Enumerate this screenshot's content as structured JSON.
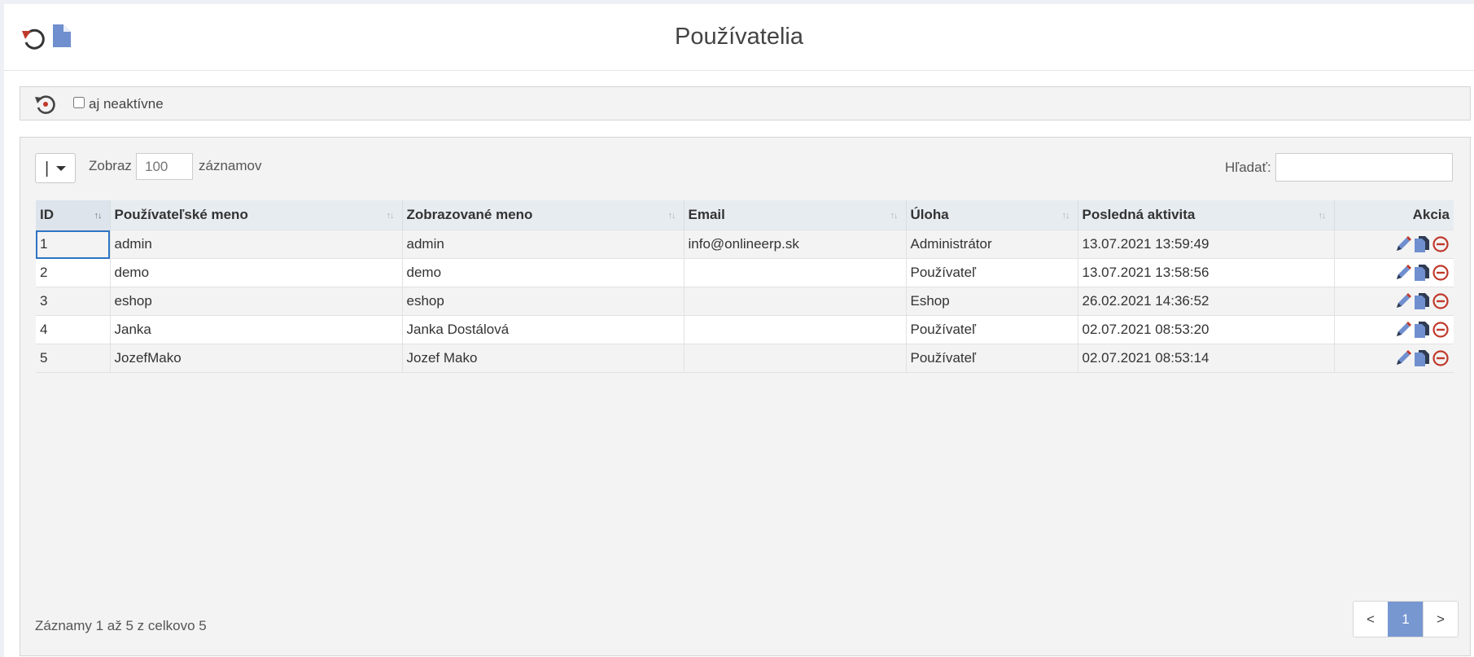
{
  "header": {
    "title": "Používatelia",
    "refresh_icon": "refresh-icon",
    "export_icon": "document-icon"
  },
  "filter": {
    "history_icon": "history-icon",
    "inactive_label": "aj neaktívne",
    "inactive_checked": false
  },
  "table_controls": {
    "length_menu_icon": "menu-icon",
    "show_label": "Zobraz",
    "length_value": "",
    "length_placeholder": "100",
    "records_label": "záznamov",
    "search_label": "Hľadať:",
    "search_value": ""
  },
  "table": {
    "columns": [
      {
        "label": "ID",
        "sort": "↑↓"
      },
      {
        "label": "Používateľské meno",
        "sort": "↑↓"
      },
      {
        "label": "Zobrazované meno",
        "sort": "↑↓"
      },
      {
        "label": "Email",
        "sort": "↑↓"
      },
      {
        "label": "Úloha",
        "sort": "↑↓"
      },
      {
        "label": "Posledná aktivita",
        "sort": "↑↓"
      },
      {
        "label": "Akcia"
      }
    ],
    "rows": [
      {
        "id": "1",
        "username": "admin",
        "display_name": "admin",
        "email": "info@onlineerp.sk",
        "role": "Administrátor",
        "last_activity": "13.07.2021 13:59:49"
      },
      {
        "id": "2",
        "username": "demo",
        "display_name": "demo",
        "email": "",
        "role": "Používateľ",
        "last_activity": "13.07.2021 13:58:56"
      },
      {
        "id": "3",
        "username": "eshop",
        "display_name": "eshop",
        "email": "",
        "role": "Eshop",
        "last_activity": "26.02.2021 14:36:52"
      },
      {
        "id": "4",
        "username": "Janka",
        "display_name": "Janka Dostálová",
        "email": "",
        "role": "Používateľ",
        "last_activity": "02.07.2021 08:53:20"
      },
      {
        "id": "5",
        "username": "JozefMako",
        "display_name": "Jozef Mako",
        "email": "",
        "role": "Používateľ",
        "last_activity": "02.07.2021 08:53:14"
      }
    ],
    "action_icons": [
      "edit-icon",
      "copy-icon",
      "delete-icon"
    ]
  },
  "footer": {
    "info": "Záznamy 1 až 5 z celkovo 5",
    "prev": "<",
    "page": "1",
    "next": ">"
  },
  "colors": {
    "accent": "#7797d1",
    "document_icon": "#6f8fcf",
    "danger": "#c0392b"
  }
}
